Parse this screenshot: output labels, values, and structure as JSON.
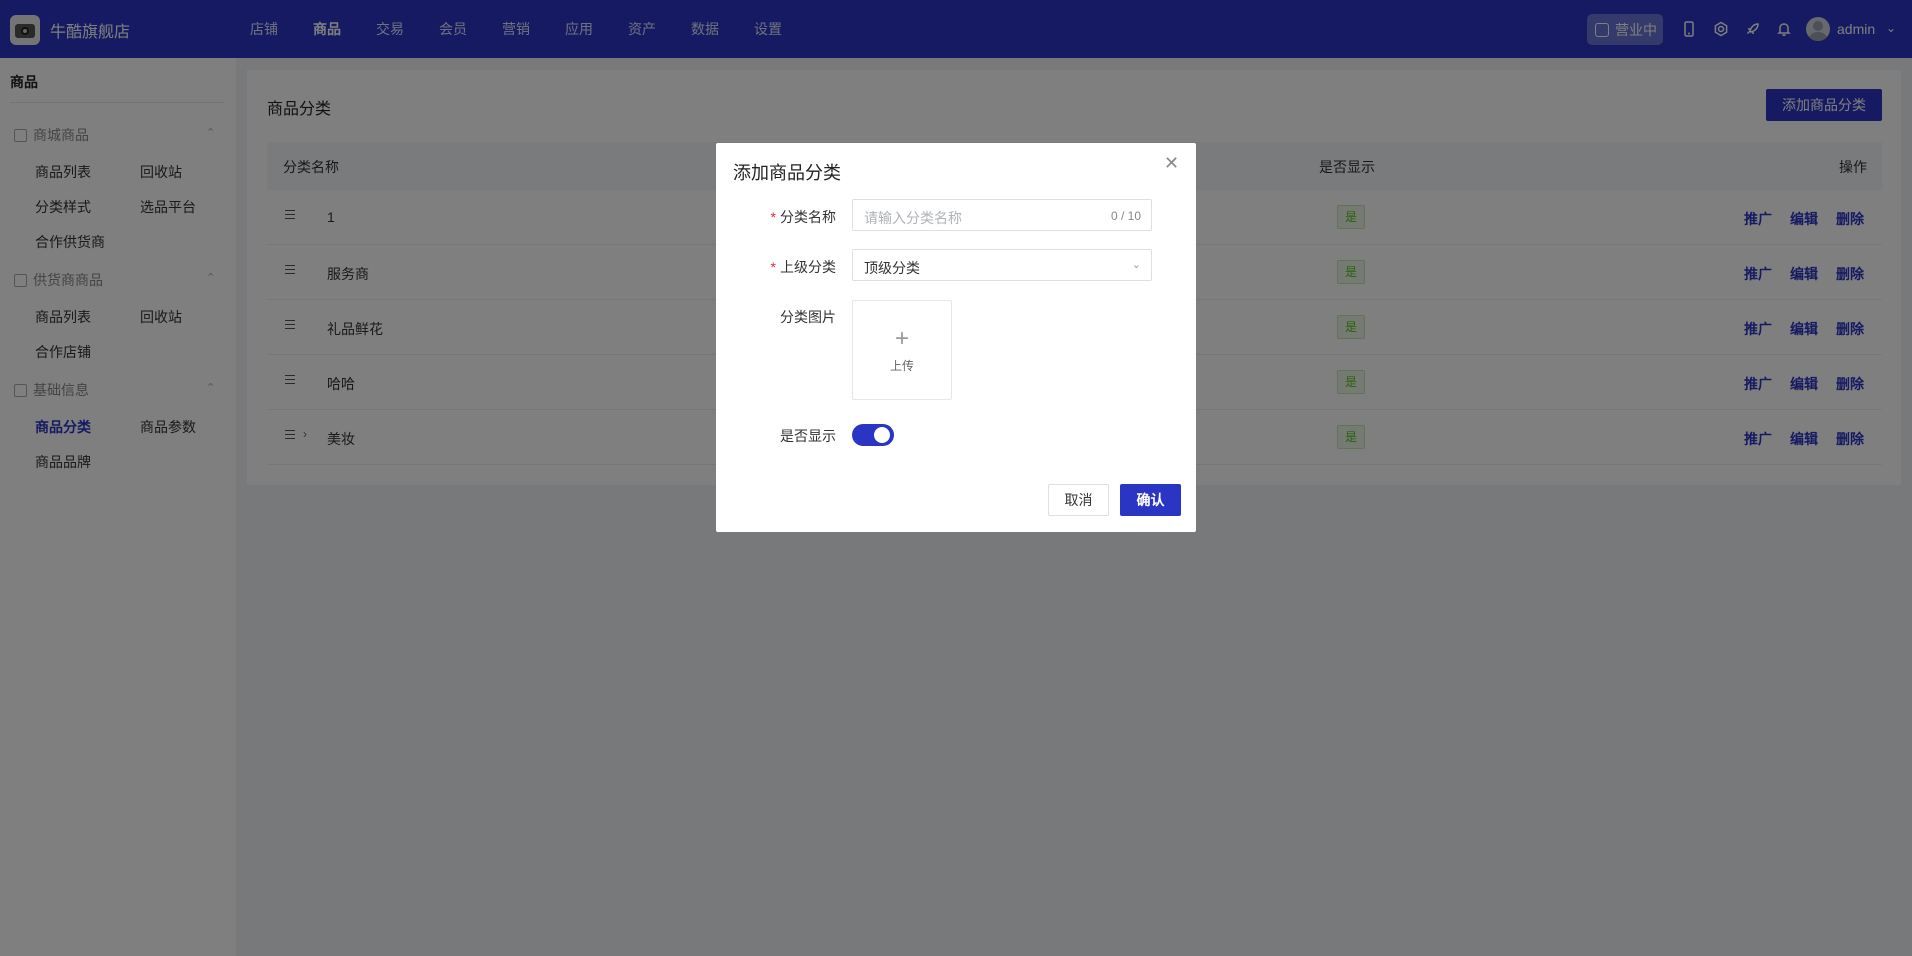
{
  "app": {
    "shop_name": "牛酷旗舰店"
  },
  "nav": [
    "店铺",
    "商品",
    "交易",
    "会员",
    "营销",
    "应用",
    "资产",
    "数据",
    "设置"
  ],
  "nav_active_index": 1,
  "header": {
    "status_label": "营业中",
    "user_name": "admin"
  },
  "sidebar": {
    "title": "商品",
    "groups": [
      {
        "label": "商城商品",
        "items": [
          "商品列表",
          "回收站",
          "分类样式",
          "选品平台",
          "合作供货商"
        ]
      },
      {
        "label": "供货商商品",
        "items": [
          "商品列表",
          "回收站",
          "合作店铺"
        ]
      },
      {
        "label": "基础信息",
        "items": [
          "商品分类",
          "商品参数",
          "商品品牌"
        ]
      }
    ],
    "active_item": "商品分类"
  },
  "page": {
    "title": "商品分类",
    "add_button": "添加商品分类",
    "columns": {
      "name": "分类名称",
      "visible": "是否显示",
      "actions": "操作"
    },
    "rows": [
      {
        "name": "1",
        "visible": "是",
        "expandable": false
      },
      {
        "name": "服务商",
        "visible": "是",
        "expandable": false
      },
      {
        "name": "礼品鲜花",
        "visible": "是",
        "expandable": false
      },
      {
        "name": "哈哈",
        "visible": "是",
        "expandable": false
      },
      {
        "name": "美妆",
        "visible": "是",
        "expandable": true
      }
    ],
    "row_actions": [
      "推广",
      "编辑",
      "删除"
    ]
  },
  "modal": {
    "title": "添加商品分类",
    "name_label": "分类名称",
    "name_placeholder": "请输入分类名称",
    "name_counter": "0 / 10",
    "parent_label": "上级分类",
    "parent_value": "顶级分类",
    "image_label": "分类图片",
    "upload_text": "上传",
    "show_label": "是否显示",
    "show_enabled": true,
    "cancel": "取消",
    "confirm": "确认"
  },
  "colors": {
    "primary": "#2a35c4",
    "success": "#52c41a",
    "required": "#f5222d"
  }
}
